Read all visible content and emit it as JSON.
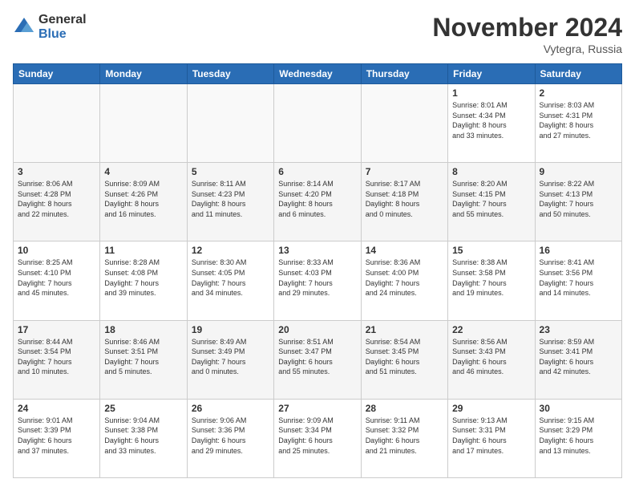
{
  "logo": {
    "general": "General",
    "blue": "Blue"
  },
  "title": "November 2024",
  "location": "Vytegra, Russia",
  "days_of_week": [
    "Sunday",
    "Monday",
    "Tuesday",
    "Wednesday",
    "Thursday",
    "Friday",
    "Saturday"
  ],
  "weeks": [
    [
      {
        "day": "",
        "info": "",
        "empty": true
      },
      {
        "day": "",
        "info": "",
        "empty": true
      },
      {
        "day": "",
        "info": "",
        "empty": true
      },
      {
        "day": "",
        "info": "",
        "empty": true
      },
      {
        "day": "",
        "info": "",
        "empty": true
      },
      {
        "day": "1",
        "info": "Sunrise: 8:01 AM\nSunset: 4:34 PM\nDaylight: 8 hours\nand 33 minutes."
      },
      {
        "day": "2",
        "info": "Sunrise: 8:03 AM\nSunset: 4:31 PM\nDaylight: 8 hours\nand 27 minutes."
      }
    ],
    [
      {
        "day": "3",
        "info": "Sunrise: 8:06 AM\nSunset: 4:28 PM\nDaylight: 8 hours\nand 22 minutes."
      },
      {
        "day": "4",
        "info": "Sunrise: 8:09 AM\nSunset: 4:26 PM\nDaylight: 8 hours\nand 16 minutes."
      },
      {
        "day": "5",
        "info": "Sunrise: 8:11 AM\nSunset: 4:23 PM\nDaylight: 8 hours\nand 11 minutes."
      },
      {
        "day": "6",
        "info": "Sunrise: 8:14 AM\nSunset: 4:20 PM\nDaylight: 8 hours\nand 6 minutes."
      },
      {
        "day": "7",
        "info": "Sunrise: 8:17 AM\nSunset: 4:18 PM\nDaylight: 8 hours\nand 0 minutes."
      },
      {
        "day": "8",
        "info": "Sunrise: 8:20 AM\nSunset: 4:15 PM\nDaylight: 7 hours\nand 55 minutes."
      },
      {
        "day": "9",
        "info": "Sunrise: 8:22 AM\nSunset: 4:13 PM\nDaylight: 7 hours\nand 50 minutes."
      }
    ],
    [
      {
        "day": "10",
        "info": "Sunrise: 8:25 AM\nSunset: 4:10 PM\nDaylight: 7 hours\nand 45 minutes."
      },
      {
        "day": "11",
        "info": "Sunrise: 8:28 AM\nSunset: 4:08 PM\nDaylight: 7 hours\nand 39 minutes."
      },
      {
        "day": "12",
        "info": "Sunrise: 8:30 AM\nSunset: 4:05 PM\nDaylight: 7 hours\nand 34 minutes."
      },
      {
        "day": "13",
        "info": "Sunrise: 8:33 AM\nSunset: 4:03 PM\nDaylight: 7 hours\nand 29 minutes."
      },
      {
        "day": "14",
        "info": "Sunrise: 8:36 AM\nSunset: 4:00 PM\nDaylight: 7 hours\nand 24 minutes."
      },
      {
        "day": "15",
        "info": "Sunrise: 8:38 AM\nSunset: 3:58 PM\nDaylight: 7 hours\nand 19 minutes."
      },
      {
        "day": "16",
        "info": "Sunrise: 8:41 AM\nSunset: 3:56 PM\nDaylight: 7 hours\nand 14 minutes."
      }
    ],
    [
      {
        "day": "17",
        "info": "Sunrise: 8:44 AM\nSunset: 3:54 PM\nDaylight: 7 hours\nand 10 minutes."
      },
      {
        "day": "18",
        "info": "Sunrise: 8:46 AM\nSunset: 3:51 PM\nDaylight: 7 hours\nand 5 minutes."
      },
      {
        "day": "19",
        "info": "Sunrise: 8:49 AM\nSunset: 3:49 PM\nDaylight: 7 hours\nand 0 minutes."
      },
      {
        "day": "20",
        "info": "Sunrise: 8:51 AM\nSunset: 3:47 PM\nDaylight: 6 hours\nand 55 minutes."
      },
      {
        "day": "21",
        "info": "Sunrise: 8:54 AM\nSunset: 3:45 PM\nDaylight: 6 hours\nand 51 minutes."
      },
      {
        "day": "22",
        "info": "Sunrise: 8:56 AM\nSunset: 3:43 PM\nDaylight: 6 hours\nand 46 minutes."
      },
      {
        "day": "23",
        "info": "Sunrise: 8:59 AM\nSunset: 3:41 PM\nDaylight: 6 hours\nand 42 minutes."
      }
    ],
    [
      {
        "day": "24",
        "info": "Sunrise: 9:01 AM\nSunset: 3:39 PM\nDaylight: 6 hours\nand 37 minutes."
      },
      {
        "day": "25",
        "info": "Sunrise: 9:04 AM\nSunset: 3:38 PM\nDaylight: 6 hours\nand 33 minutes."
      },
      {
        "day": "26",
        "info": "Sunrise: 9:06 AM\nSunset: 3:36 PM\nDaylight: 6 hours\nand 29 minutes."
      },
      {
        "day": "27",
        "info": "Sunrise: 9:09 AM\nSunset: 3:34 PM\nDaylight: 6 hours\nand 25 minutes."
      },
      {
        "day": "28",
        "info": "Sunrise: 9:11 AM\nSunset: 3:32 PM\nDaylight: 6 hours\nand 21 minutes."
      },
      {
        "day": "29",
        "info": "Sunrise: 9:13 AM\nSunset: 3:31 PM\nDaylight: 6 hours\nand 17 minutes."
      },
      {
        "day": "30",
        "info": "Sunrise: 9:15 AM\nSunset: 3:29 PM\nDaylight: 6 hours\nand 13 minutes."
      }
    ]
  ]
}
